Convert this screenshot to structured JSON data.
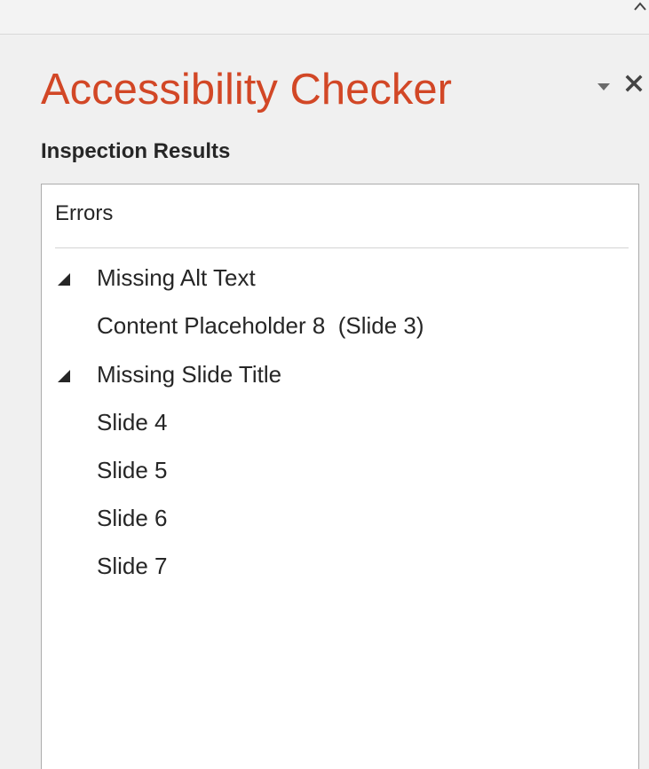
{
  "pane": {
    "title": "Accessibility Checker",
    "title_color": "#d24726",
    "section_heading": "Inspection Results",
    "options_icon": "triangle-down-icon",
    "close_icon": "close-icon",
    "collapse_icon": "chevron-up-icon"
  },
  "results": {
    "header": "Errors",
    "groups": [
      {
        "label": "Missing Alt Text",
        "expanded": true,
        "items": [
          {
            "label": "Content Placeholder 8  (Slide 3)"
          }
        ]
      },
      {
        "label": "Missing Slide Title",
        "expanded": true,
        "items": [
          {
            "label": "Slide 4"
          },
          {
            "label": "Slide 5"
          },
          {
            "label": "Slide 6"
          },
          {
            "label": "Slide 7"
          }
        ]
      }
    ]
  }
}
